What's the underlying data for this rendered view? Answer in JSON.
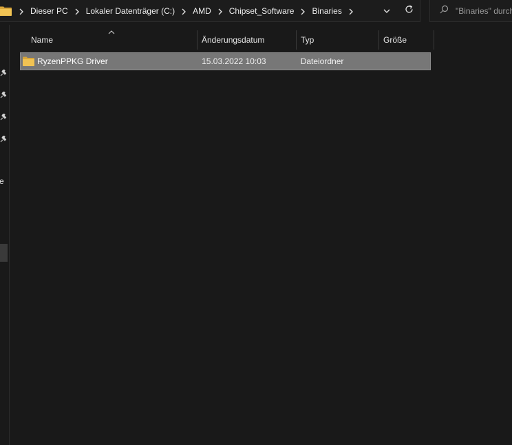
{
  "address_bar": {
    "crumbs": [
      "Dieser PC",
      "Lokaler Datenträger (C:)",
      "AMD",
      "Chipset_Software",
      "Binaries"
    ]
  },
  "search": {
    "placeholder": "\"Binaries\" durchsuchen"
  },
  "nav_pane": {
    "partial_text": "e"
  },
  "columns": {
    "name": "Name",
    "date": "Änderungsdatum",
    "type": "Typ",
    "size": "Größe"
  },
  "files": [
    {
      "name": "RyzenPPKG Driver",
      "date": "15.03.2022 10:03",
      "type": "Dateiordner",
      "size": ""
    }
  ],
  "colors": {
    "background": "#191919",
    "selected_row": "#777777",
    "folder": "#e8b84a"
  },
  "icons": [
    "folder-icon",
    "chevron-right-icon",
    "chevron-down-icon",
    "refresh-icon",
    "search-icon",
    "pin-icon",
    "sort-up-icon"
  ]
}
